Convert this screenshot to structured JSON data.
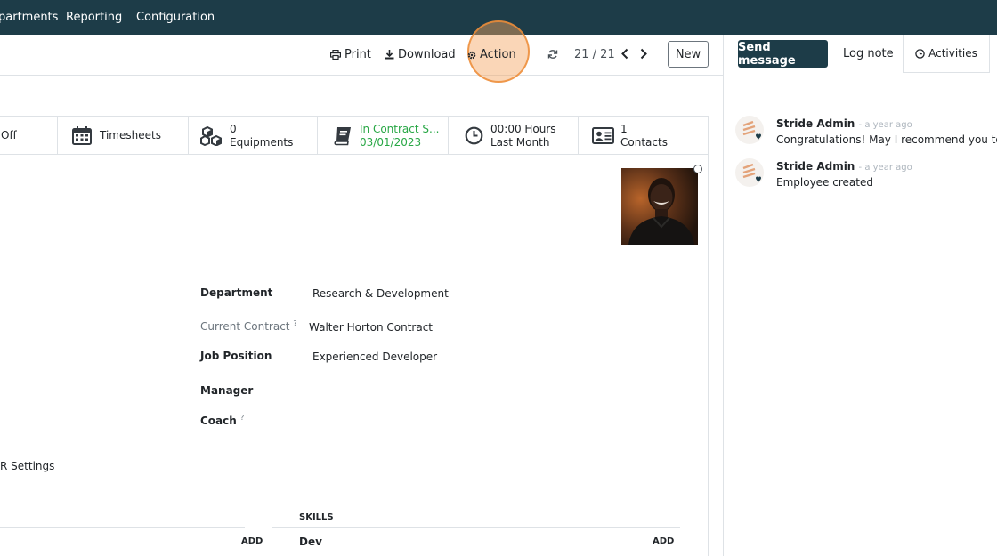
{
  "topnav": {
    "items": [
      "partments",
      "Reporting",
      "Configuration"
    ]
  },
  "control_panel": {
    "print_label": "Print",
    "download_label": "Download",
    "action_label": "Action",
    "pager": "21 / 21",
    "new_label": "New"
  },
  "smart_buttons": {
    "timeoff_label": "Off",
    "timesheets_label": "Timesheets",
    "equipments_count": "0",
    "equipments_label": "Equipments",
    "contract_label": "In Contract S...",
    "contract_date": "03/01/2023",
    "hours_value": "00:00 Hours",
    "hours_label": "Last Month",
    "contacts_count": "1",
    "contacts_label": "Contacts"
  },
  "form": {
    "department_label": "Department",
    "department_value": "Research & Development",
    "contract_label": "Current Contract",
    "contract_help": "?",
    "contract_value": "Walter Horton Contract",
    "job_label": "Job Position",
    "job_value": "Experienced Developer",
    "manager_label": "Manager",
    "coach_label": "Coach",
    "coach_help": "?"
  },
  "tabs": {
    "hr_settings_label": "R Settings"
  },
  "resume": {
    "add_left": "ADD",
    "skills_header": "SKILLS",
    "skill_type": "Dev",
    "add_right": "ADD"
  },
  "chatter": {
    "send_message_label": "Send message",
    "log_note_label": "Log note",
    "activities_label": "Activities",
    "messages": [
      {
        "author": "Stride Admin",
        "time": "- a year ago",
        "body": "Congratulations! May I recommend you to s"
      },
      {
        "author": "Stride Admin",
        "time": "- a year ago",
        "body": "Employee created"
      }
    ]
  },
  "colors": {
    "nav_bg": "#1d3c48",
    "success_green": "#28a745",
    "highlight_orange": "#f3a560"
  }
}
